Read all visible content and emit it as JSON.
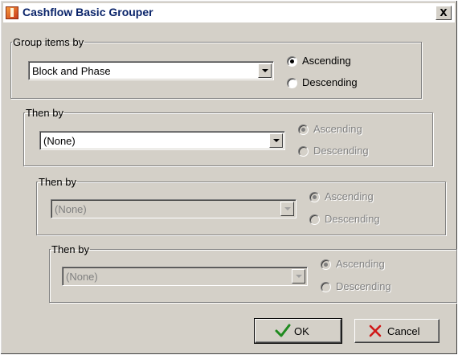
{
  "window": {
    "title": "Cashflow Basic Grouper",
    "close_label": "X"
  },
  "groups": [
    {
      "legend": "Group items by",
      "selected": "Block and Phase",
      "enabled": true,
      "sort": "ascending",
      "ascending_label": "Ascending",
      "descending_label": "Descending"
    },
    {
      "legend": "Then by",
      "selected": "(None)",
      "enabled": true,
      "sort": "ascending",
      "ascending_label": "Ascending",
      "descending_label": "Descending"
    },
    {
      "legend": "Then by",
      "selected": "(None)",
      "enabled": false,
      "sort": "ascending",
      "ascending_label": "Ascending",
      "descending_label": "Descending"
    },
    {
      "legend": "Then by",
      "selected": "(None)",
      "enabled": false,
      "sort": "ascending",
      "ascending_label": "Ascending",
      "descending_label": "Descending"
    }
  ],
  "buttons": {
    "ok_label": "OK",
    "cancel_label": "Cancel"
  },
  "icons": {
    "ok_icon": "checkmark-icon",
    "cancel_icon": "x-icon",
    "ok_color": "#1f8a1f",
    "cancel_color": "#d01818"
  }
}
